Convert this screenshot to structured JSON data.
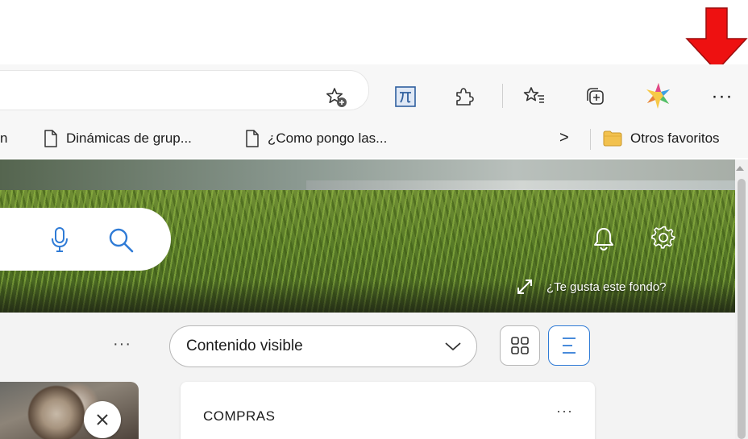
{
  "toolbar": {
    "more_label": "···",
    "icons": [
      "add-favorite-icon",
      "pi-extension-icon",
      "extensions-puzzle-icon",
      "favorites-icon",
      "collections-icon",
      "copilot-icon"
    ]
  },
  "favorites_bar": {
    "partial_label": "n",
    "items": [
      {
        "label": "Dinámicas de grup..."
      },
      {
        "label": "¿Como pongo las..."
      }
    ],
    "chevron": ">",
    "other_favorites": "Otros favoritos"
  },
  "hero": {
    "like_background_label": "¿Te gusta este fondo?"
  },
  "content": {
    "more_label": "···",
    "dropdown_value": "Contenido visible",
    "card": {
      "title": "COMPRAS",
      "more_label": "···"
    }
  },
  "colors": {
    "annotation_arrow": "#ee1111",
    "accent_blue": "#2f7bd6",
    "folder_yellow": "#f2c14e"
  }
}
